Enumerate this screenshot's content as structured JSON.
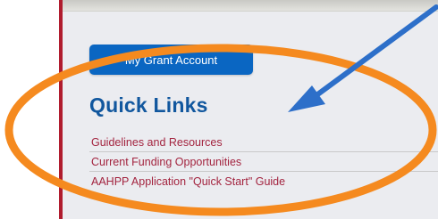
{
  "sidebar_panel": {
    "grant_button_label": "My Grant Account",
    "quick_links_heading": "Quick Links",
    "links": [
      {
        "label": "Guidelines and Resources"
      },
      {
        "label": "Current Funding Opportunities"
      },
      {
        "label": "AAHPP Application \"Quick Start\" Guide"
      }
    ]
  },
  "colors": {
    "panel_background": "#ebecf0",
    "left_border": "#b01c2e",
    "button_blue": "#0a66c2",
    "heading_blue": "#11579e",
    "link_red": "#a3243f",
    "annotation_orange": "#f58a1f",
    "annotation_arrow": "#2d6fc9"
  },
  "annotations": {
    "highlight": "orange-ellipse",
    "pointer": "blue-arrow"
  }
}
